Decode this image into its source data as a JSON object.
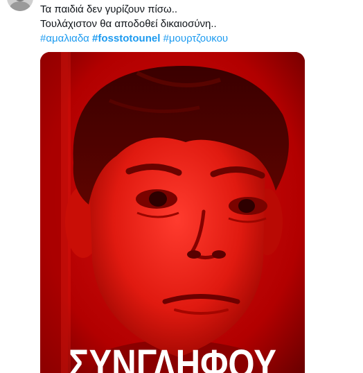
{
  "tweet": {
    "text_line_1": "Τα παιδιά δεν γυρίζουν πίσω..",
    "text_line_2": "Τουλάχιστον θα αποδοθεί δικαιοσύνη..",
    "hashtags": [
      "#αμαλιαδα",
      "#fosstotounel",
      "#μουρτζουκου"
    ]
  },
  "media": {
    "overlay_text": "ΣΥΝΓΛΗΦΟΥ",
    "tint_color": "#c20000"
  },
  "colors": {
    "text": "#0f1419",
    "link": "#1d9bf0"
  }
}
